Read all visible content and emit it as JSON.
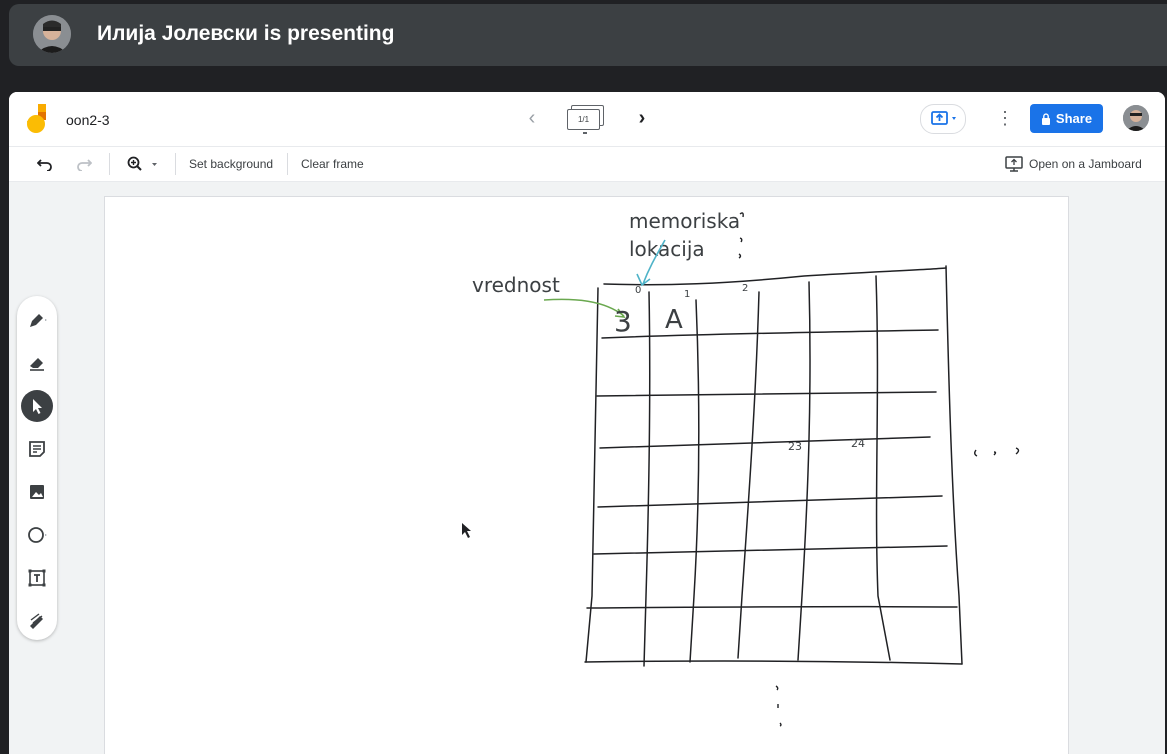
{
  "presenter": {
    "text": "Илија Јолевски is presenting"
  },
  "jamboard": {
    "title": "oon2-3",
    "frame_indicator": "1/1",
    "share_label": "Share"
  },
  "toolbar": {
    "set_background": "Set background",
    "clear_frame": "Clear frame",
    "open_on_jamboard": "Open on a Jamboard"
  },
  "board": {
    "label_memory_line1": "memoriska",
    "label_memory_line2": "lokacija",
    "label_value": "vrednost",
    "cell_value_1": "3",
    "cell_value_2": "A",
    "index_0": "0",
    "index_1": "1",
    "index_2": "2",
    "index_23": "23",
    "index_24": "24"
  },
  "colors": {
    "accent": "#1a73e8",
    "memory_arrow": "#4fb3c8",
    "value_arrow": "#6aa84f",
    "ink": "#202124"
  },
  "icons": [
    "pen-icon",
    "eraser-icon",
    "select-icon",
    "sticky-note-icon",
    "image-icon",
    "circle-icon",
    "text-box-icon",
    "laser-icon"
  ]
}
